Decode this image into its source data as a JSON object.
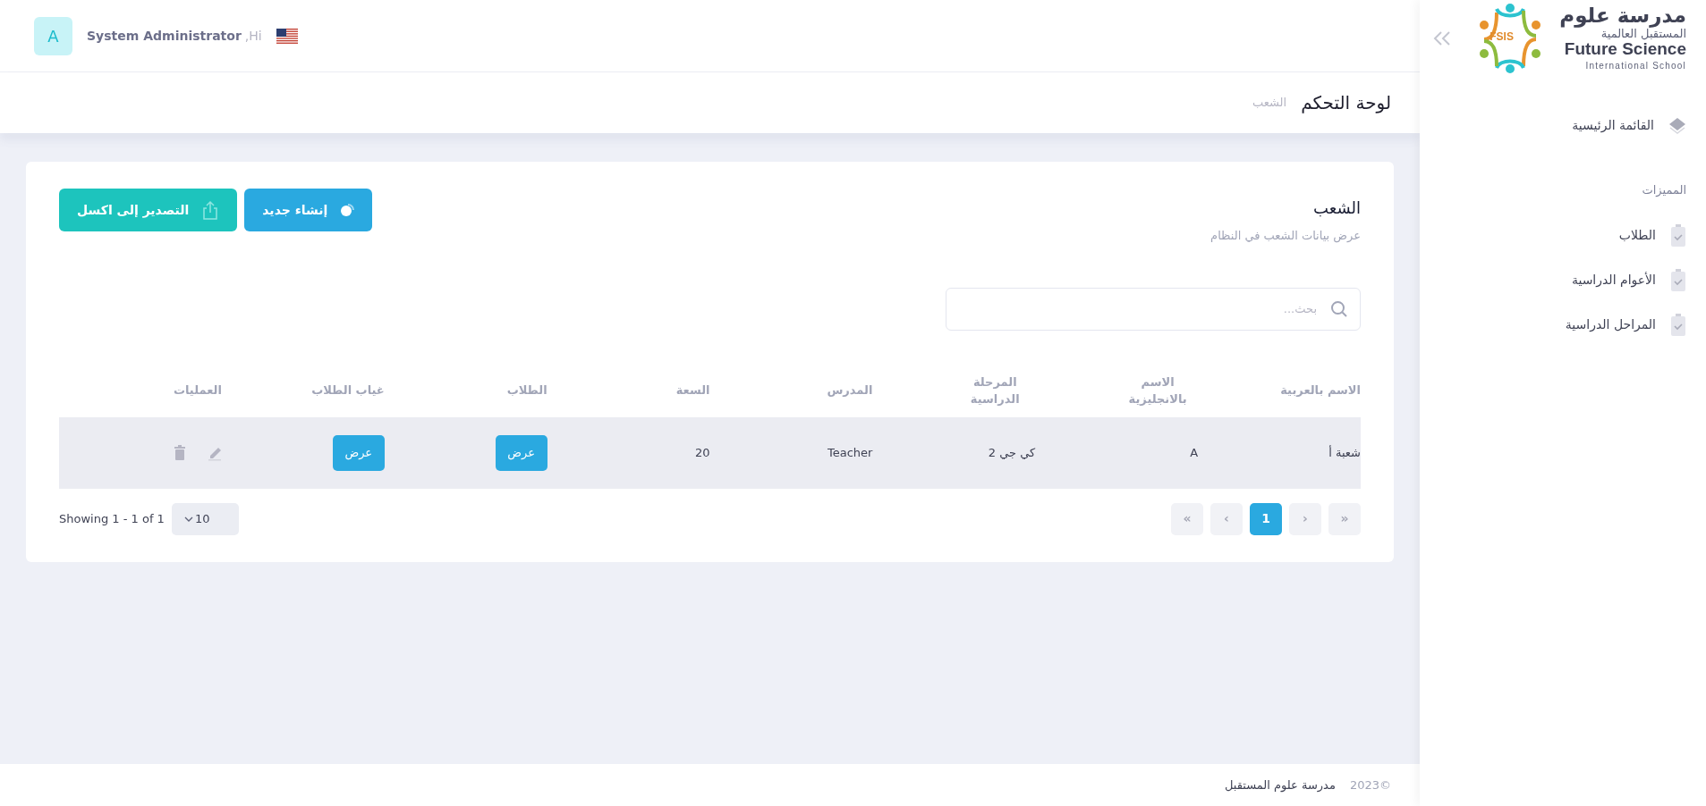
{
  "header": {
    "avatar_letter": "A",
    "user_name": "System Administrator",
    "greeting": ",Hi"
  },
  "breadcrumb": {
    "title": "لوحة التحكم",
    "current": "الشعب"
  },
  "card": {
    "title": "الشعب",
    "subtitle": "عرض بيانات الشعب في النظام",
    "buttons": [
      {
        "label": "إنشاء جديد",
        "kind": "create"
      },
      {
        "label": "التصدير إلى اكسل",
        "kind": "export"
      }
    ]
  },
  "search": {
    "placeholder": "بحث..."
  },
  "table": {
    "columns": [
      "الاسم بالعربية",
      "الاسم بالانجليزية",
      "المرحلة الدراسية",
      "المدرس",
      "السعة",
      "الطلاب",
      "غياب الطلاب",
      "العمليات"
    ],
    "rows": [
      {
        "name_ar": "شعبة أ",
        "name_en": "A",
        "stage": "كي جي 2",
        "teacher": "Teacher",
        "capacity": "20",
        "students_button": "عرض",
        "absence_button": "عرض"
      }
    ]
  },
  "pagination": {
    "pages": [
      {
        "label": "»",
        "disabled": true,
        "selected": false
      },
      {
        "label": "›",
        "disabled": true,
        "selected": false
      },
      {
        "label": "1",
        "disabled": false,
        "selected": true
      },
      {
        "label": "‹",
        "disabled": true,
        "selected": false
      },
      {
        "label": "«",
        "disabled": true,
        "selected": false
      }
    ],
    "page_size": "10",
    "summary": "Showing 1 - 1 of 1"
  },
  "footer": {
    "year": "©2023",
    "owner": "مدرسة علوم المستقبل"
  },
  "sidebar": {
    "logo": {
      "arabic_name": "مدرسة علوم",
      "arabic_subtitle": "المستقبل العالمية",
      "english_name": "Future Science",
      "english_subtitle": "International School",
      "initials": "FSIS"
    },
    "items": [
      {
        "label": "القائمة الرئيسية",
        "kind": "home"
      }
    ],
    "section_title": "المميزات",
    "section_items": [
      {
        "label": "الطلاب"
      },
      {
        "label": "الأعوام الدراسية"
      },
      {
        "label": "المراحل الدراسية"
      }
    ]
  }
}
